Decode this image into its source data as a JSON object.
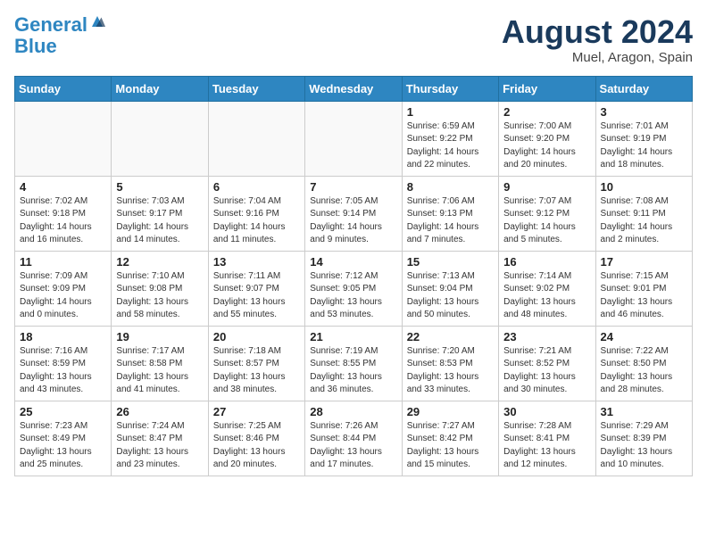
{
  "header": {
    "logo_line1": "General",
    "logo_line2": "Blue",
    "month_year": "August 2024",
    "location": "Muel, Aragon, Spain"
  },
  "weekdays": [
    "Sunday",
    "Monday",
    "Tuesday",
    "Wednesday",
    "Thursday",
    "Friday",
    "Saturday"
  ],
  "weeks": [
    [
      {
        "day": "",
        "info": ""
      },
      {
        "day": "",
        "info": ""
      },
      {
        "day": "",
        "info": ""
      },
      {
        "day": "",
        "info": ""
      },
      {
        "day": "1",
        "info": "Sunrise: 6:59 AM\nSunset: 9:22 PM\nDaylight: 14 hours\nand 22 minutes."
      },
      {
        "day": "2",
        "info": "Sunrise: 7:00 AM\nSunset: 9:20 PM\nDaylight: 14 hours\nand 20 minutes."
      },
      {
        "day": "3",
        "info": "Sunrise: 7:01 AM\nSunset: 9:19 PM\nDaylight: 14 hours\nand 18 minutes."
      }
    ],
    [
      {
        "day": "4",
        "info": "Sunrise: 7:02 AM\nSunset: 9:18 PM\nDaylight: 14 hours\nand 16 minutes."
      },
      {
        "day": "5",
        "info": "Sunrise: 7:03 AM\nSunset: 9:17 PM\nDaylight: 14 hours\nand 14 minutes."
      },
      {
        "day": "6",
        "info": "Sunrise: 7:04 AM\nSunset: 9:16 PM\nDaylight: 14 hours\nand 11 minutes."
      },
      {
        "day": "7",
        "info": "Sunrise: 7:05 AM\nSunset: 9:14 PM\nDaylight: 14 hours\nand 9 minutes."
      },
      {
        "day": "8",
        "info": "Sunrise: 7:06 AM\nSunset: 9:13 PM\nDaylight: 14 hours\nand 7 minutes."
      },
      {
        "day": "9",
        "info": "Sunrise: 7:07 AM\nSunset: 9:12 PM\nDaylight: 14 hours\nand 5 minutes."
      },
      {
        "day": "10",
        "info": "Sunrise: 7:08 AM\nSunset: 9:11 PM\nDaylight: 14 hours\nand 2 minutes."
      }
    ],
    [
      {
        "day": "11",
        "info": "Sunrise: 7:09 AM\nSunset: 9:09 PM\nDaylight: 14 hours\nand 0 minutes."
      },
      {
        "day": "12",
        "info": "Sunrise: 7:10 AM\nSunset: 9:08 PM\nDaylight: 13 hours\nand 58 minutes."
      },
      {
        "day": "13",
        "info": "Sunrise: 7:11 AM\nSunset: 9:07 PM\nDaylight: 13 hours\nand 55 minutes."
      },
      {
        "day": "14",
        "info": "Sunrise: 7:12 AM\nSunset: 9:05 PM\nDaylight: 13 hours\nand 53 minutes."
      },
      {
        "day": "15",
        "info": "Sunrise: 7:13 AM\nSunset: 9:04 PM\nDaylight: 13 hours\nand 50 minutes."
      },
      {
        "day": "16",
        "info": "Sunrise: 7:14 AM\nSunset: 9:02 PM\nDaylight: 13 hours\nand 48 minutes."
      },
      {
        "day": "17",
        "info": "Sunrise: 7:15 AM\nSunset: 9:01 PM\nDaylight: 13 hours\nand 46 minutes."
      }
    ],
    [
      {
        "day": "18",
        "info": "Sunrise: 7:16 AM\nSunset: 8:59 PM\nDaylight: 13 hours\nand 43 minutes."
      },
      {
        "day": "19",
        "info": "Sunrise: 7:17 AM\nSunset: 8:58 PM\nDaylight: 13 hours\nand 41 minutes."
      },
      {
        "day": "20",
        "info": "Sunrise: 7:18 AM\nSunset: 8:57 PM\nDaylight: 13 hours\nand 38 minutes."
      },
      {
        "day": "21",
        "info": "Sunrise: 7:19 AM\nSunset: 8:55 PM\nDaylight: 13 hours\nand 36 minutes."
      },
      {
        "day": "22",
        "info": "Sunrise: 7:20 AM\nSunset: 8:53 PM\nDaylight: 13 hours\nand 33 minutes."
      },
      {
        "day": "23",
        "info": "Sunrise: 7:21 AM\nSunset: 8:52 PM\nDaylight: 13 hours\nand 30 minutes."
      },
      {
        "day": "24",
        "info": "Sunrise: 7:22 AM\nSunset: 8:50 PM\nDaylight: 13 hours\nand 28 minutes."
      }
    ],
    [
      {
        "day": "25",
        "info": "Sunrise: 7:23 AM\nSunset: 8:49 PM\nDaylight: 13 hours\nand 25 minutes."
      },
      {
        "day": "26",
        "info": "Sunrise: 7:24 AM\nSunset: 8:47 PM\nDaylight: 13 hours\nand 23 minutes."
      },
      {
        "day": "27",
        "info": "Sunrise: 7:25 AM\nSunset: 8:46 PM\nDaylight: 13 hours\nand 20 minutes."
      },
      {
        "day": "28",
        "info": "Sunrise: 7:26 AM\nSunset: 8:44 PM\nDaylight: 13 hours\nand 17 minutes."
      },
      {
        "day": "29",
        "info": "Sunrise: 7:27 AM\nSunset: 8:42 PM\nDaylight: 13 hours\nand 15 minutes."
      },
      {
        "day": "30",
        "info": "Sunrise: 7:28 AM\nSunset: 8:41 PM\nDaylight: 13 hours\nand 12 minutes."
      },
      {
        "day": "31",
        "info": "Sunrise: 7:29 AM\nSunset: 8:39 PM\nDaylight: 13 hours\nand 10 minutes."
      }
    ]
  ]
}
